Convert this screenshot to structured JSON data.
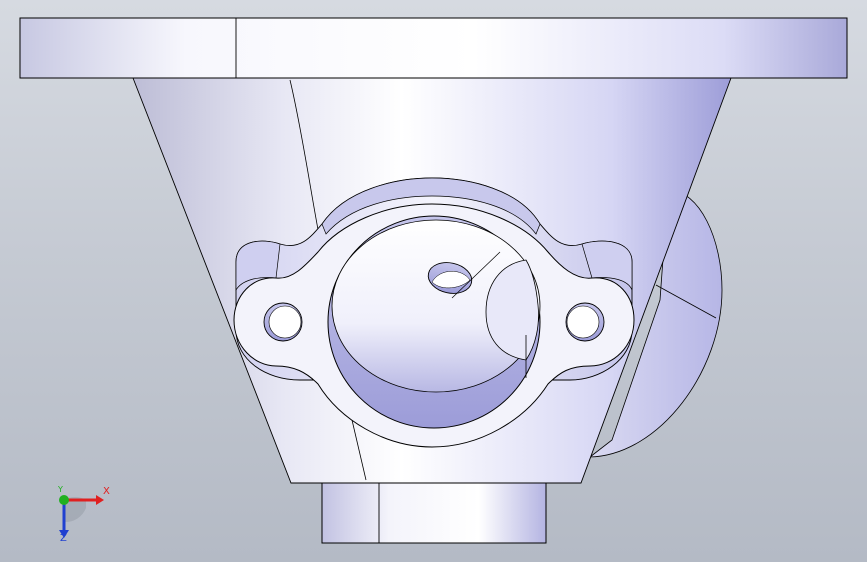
{
  "view": {
    "background_top": "#d6dae1",
    "background_bottom": "#b4bac5",
    "part_color": "#d9dcf3",
    "edge_color": "#000000"
  },
  "triad": {
    "x_label": "X",
    "y_label": "Y",
    "z_label": "Z",
    "x_color": "#e02020",
    "y_color": "#20b020",
    "z_color": "#2040d0"
  }
}
